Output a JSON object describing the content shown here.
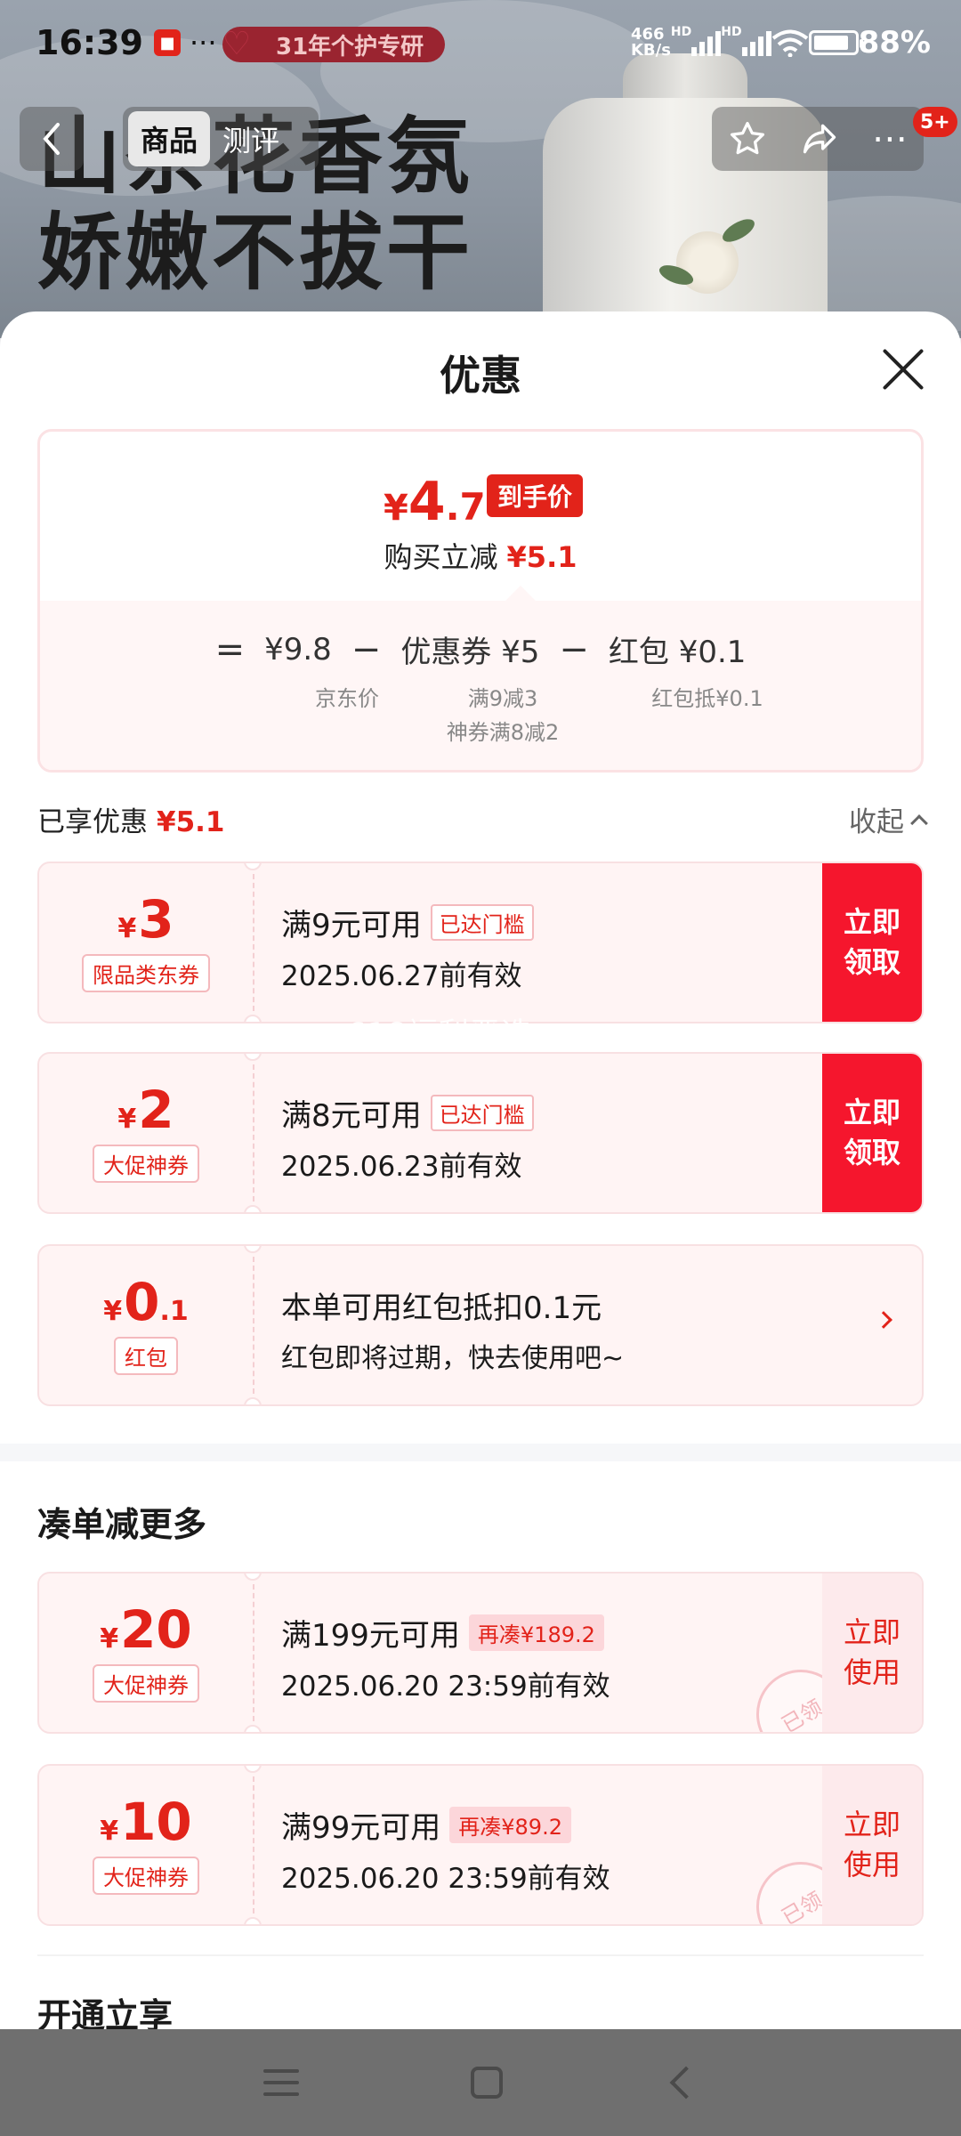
{
  "status_bar": {
    "time": "16:39",
    "dots": "···",
    "promo_tag": "31年个护专研",
    "net_speed_value": "466",
    "net_speed_unit": "KB/s",
    "hd1": "HD",
    "hd2": "HD",
    "battery_level": 0.88,
    "battery_text": "88%"
  },
  "background": {
    "headline_1": "山茶花香氛",
    "headline_2": "娇嫩不拔干"
  },
  "nav": {
    "tab_product": "商品",
    "tab_review": "测评",
    "badge": "5+",
    "icons": [
      "back-icon",
      "star-icon",
      "share-icon",
      "more-icon"
    ]
  },
  "sheet": {
    "title": "优惠",
    "summary": {
      "yen": "¥",
      "final_int": "4",
      "final_dec": ".7",
      "final_tag": "到手价",
      "instant_label": "购买立减",
      "instant_amount": "¥5.1",
      "eq": "=",
      "jd_price": "¥9.8",
      "minus1": "−",
      "coupon_price": "优惠券 ¥5",
      "minus2": "−",
      "hongbao_price": "红包 ¥0.1",
      "jd_price_label": "京东价",
      "coupon_sub1": "满9减3",
      "coupon_sub2": "神券满8减2",
      "hongbao_sub": "红包抵¥0.1"
    },
    "saved_label": "已享优惠",
    "saved_amount": "¥5.1",
    "collapse_label": "收起",
    "watermark": "618福利严选",
    "coupons": [
      {
        "yen": "¥",
        "amount": "3",
        "decimal": "",
        "kind": "限品类东券",
        "condition": "满9元可用",
        "tag": "已达门槛",
        "valid": "2025.06.27前有效",
        "action": "立即\n领取"
      },
      {
        "yen": "¥",
        "amount": "2",
        "decimal": "",
        "kind": "大促神券",
        "condition": "满8元可用",
        "tag": "已达门槛",
        "valid": "2025.06.23前有效",
        "action": "立即\n领取"
      },
      {
        "yen": "¥",
        "amount": "0",
        "decimal": ".1",
        "kind": "红包",
        "condition": "本单可用红包抵扣0.1元",
        "tag": "",
        "valid": "红包即将过期，快去使用吧~",
        "action": ""
      }
    ],
    "more_section_title": "凑单减更多",
    "more_coupons": [
      {
        "yen": "¥",
        "amount": "20",
        "kind": "大促神券",
        "condition": "满199元可用",
        "tag": "再凑¥189.2",
        "valid": "2025.06.20 23:59前有效",
        "action": "立即\n使用",
        "stamp": "已领"
      },
      {
        "yen": "¥",
        "amount": "10",
        "kind": "大促神券",
        "condition": "满99元可用",
        "tag": "再凑¥89.2",
        "valid": "2025.06.20 23:59前有效",
        "action": "立即\n使用",
        "stamp": "已领"
      }
    ],
    "open_section_title": "开通立享"
  },
  "colors": {
    "accent_red": "#e2231a",
    "coupon_bg": "#fff4f4",
    "action_red": "#f5162d"
  }
}
